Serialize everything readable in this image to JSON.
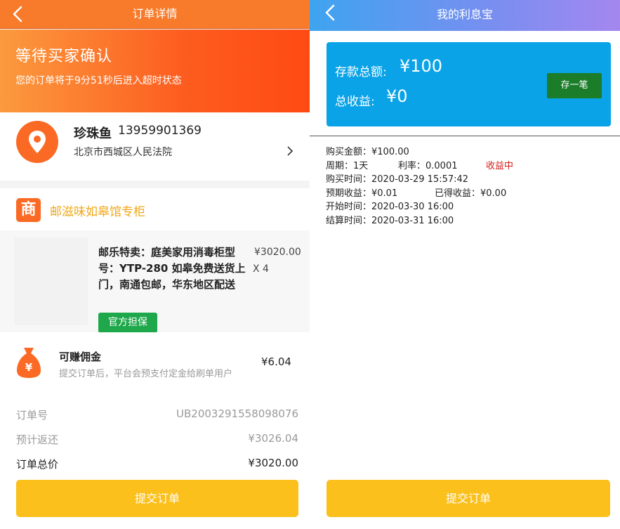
{
  "left": {
    "topbar": {
      "title": "订单详情"
    },
    "status": {
      "title": "等待买家确认",
      "subtitle": "您的订单将于9分51秒后进入超时状态"
    },
    "address": {
      "name": "珍珠鱼",
      "phone": "13959901369",
      "line": "北京市西城区人民法院",
      "icon": "location-pin-icon"
    },
    "shop": {
      "icon_char": "商",
      "name": "邮滋味如皋馆专柜"
    },
    "product": {
      "title": "邮乐特卖：庭美家用消毒柜型号：YTP-280 如皋免费送货上门，南通包邮，华东地区配送",
      "price": "¥3020.00",
      "qty": "X 4",
      "badge": "官方担保"
    },
    "commission": {
      "title": "可赚佣金",
      "desc": "提交订单后，平台会预支付定金给刷单用户",
      "amount": "¥6.04"
    },
    "summary": {
      "order_no_label": "订单号",
      "order_no": "UB2003291558098076",
      "refund_label": "预计返还",
      "refund": "¥3026.04",
      "total_label": "订单总价",
      "total": "¥3020.00"
    },
    "submit_label": "提交订单",
    "colors": {
      "accent": "#fb6a24",
      "button": "#fbc01c",
      "badge": "#1ea84b"
    }
  },
  "right": {
    "topbar": {
      "title": "我的利息宝"
    },
    "savings": {
      "deposit_label": "存款总额:",
      "deposit_value": "¥100",
      "earn_label": "总收益:",
      "earn_value": "¥0",
      "button": "存一笔"
    },
    "details": {
      "purchase_amount": "购买金额：¥100.00",
      "period": "周期：1天",
      "rate": "利率：0.0001",
      "status": "收益中",
      "purchase_time": "购买时间：2020-03-29 15:57:42",
      "expected": "预期收益：¥0.01",
      "earned": "已得收益：¥0.00",
      "start_time": "开始时间：2020-03-30 16:00",
      "settle_time": "结算时间：2020-03-31 16:00"
    },
    "submit_label": "提交订单",
    "colors": {
      "card": "#0aa3e8",
      "deposit_button": "#1b7c2a",
      "status": "#d2201c"
    }
  }
}
